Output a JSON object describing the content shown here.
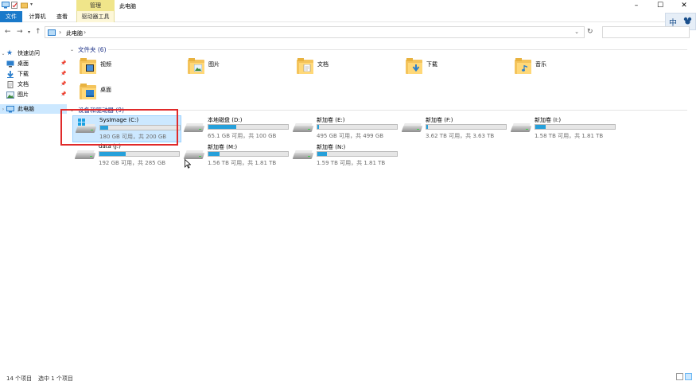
{
  "window": {
    "title": "此电脑",
    "context_tab": "管理"
  },
  "ribbon": {
    "tabs": {
      "file": "文件",
      "computer": "计算机",
      "view": "查看",
      "drive_tools": "驱动器工具"
    }
  },
  "ime": {
    "mode": "中"
  },
  "address": {
    "location": "此电脑"
  },
  "navpane": {
    "quick_access": "快速访问",
    "items": [
      "桌面",
      "下载",
      "文档",
      "图片"
    ],
    "this_pc": "此电脑"
  },
  "groups": {
    "folders_header": "文件夹 (6)",
    "devices_header": "设备和驱动器 (9)"
  },
  "folders": [
    "视频",
    "图片",
    "文档",
    "下载",
    "音乐",
    "桌面"
  ],
  "drives": [
    {
      "name": "SysImage (C:)",
      "free_text": "180 GB 可用，共 200 GB",
      "used_fraction": 0.1
    },
    {
      "name": "本地磁盘 (D:)",
      "free_text": "65.1 GB 可用，共 100 GB",
      "used_fraction": 0.35
    },
    {
      "name": "新加卷 (E:)",
      "free_text": "495 GB 可用，共 499 GB",
      "used_fraction": 0.01
    },
    {
      "name": "新加卷 (F:)",
      "free_text": "3.62 TB 可用，共 3.63 TB",
      "used_fraction": 0.003
    },
    {
      "name": "新加卷 (I:)",
      "free_text": "1.58 TB 可用，共 1.81 TB",
      "used_fraction": 0.13
    },
    {
      "name": "data (J:)",
      "free_text": "192 GB 可用，共 285 GB",
      "used_fraction": 0.33
    },
    {
      "name": "新加卷 (M:)",
      "free_text": "1.56 TB 可用，共 1.81 TB",
      "used_fraction": 0.14
    },
    {
      "name": "新加卷 (N:)",
      "free_text": "1.59 TB 可用，共 1.81 TB",
      "used_fraction": 0.12
    }
  ],
  "status": {
    "item_count": "14 个项目",
    "selected": "选中 1 个项目"
  },
  "colors": {
    "accent": "#1979ca",
    "drive_fill": "#26a0da",
    "selection": "#cce8ff",
    "highlight_box": "#e02a2a"
  }
}
